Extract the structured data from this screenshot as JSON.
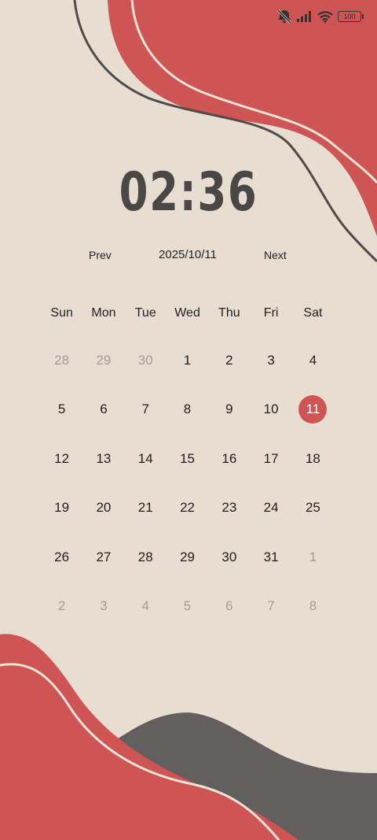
{
  "status_bar": {
    "icons": [
      "mute-icon",
      "signal-icon",
      "wifi-icon"
    ],
    "battery_level": "100"
  },
  "clock": {
    "time": "02:36"
  },
  "navigation": {
    "prev_label": "Prev",
    "current_date": "2025/10/11",
    "next_label": "Next"
  },
  "calendar": {
    "weekdays": [
      "Sun",
      "Mon",
      "Tue",
      "Wed",
      "Thu",
      "Fri",
      "Sat"
    ],
    "days": [
      {
        "label": "28",
        "muted": true
      },
      {
        "label": "29",
        "muted": true
      },
      {
        "label": "30",
        "muted": true
      },
      {
        "label": "1"
      },
      {
        "label": "2"
      },
      {
        "label": "3"
      },
      {
        "label": "4"
      },
      {
        "label": "5"
      },
      {
        "label": "6"
      },
      {
        "label": "7"
      },
      {
        "label": "8"
      },
      {
        "label": "9"
      },
      {
        "label": "10"
      },
      {
        "label": "11",
        "selected": true
      },
      {
        "label": "12"
      },
      {
        "label": "13"
      },
      {
        "label": "14"
      },
      {
        "label": "15"
      },
      {
        "label": "16"
      },
      {
        "label": "17"
      },
      {
        "label": "18"
      },
      {
        "label": "19"
      },
      {
        "label": "20"
      },
      {
        "label": "21"
      },
      {
        "label": "22"
      },
      {
        "label": "23"
      },
      {
        "label": "24"
      },
      {
        "label": "25"
      },
      {
        "label": "26"
      },
      {
        "label": "27"
      },
      {
        "label": "28"
      },
      {
        "label": "29"
      },
      {
        "label": "30"
      },
      {
        "label": "31"
      },
      {
        "label": "1",
        "muted": true
      },
      {
        "label": "2",
        "muted": true
      },
      {
        "label": "3",
        "muted": true
      },
      {
        "label": "4",
        "muted": true
      },
      {
        "label": "5",
        "muted": true
      },
      {
        "label": "6",
        "muted": true
      },
      {
        "label": "7",
        "muted": true
      },
      {
        "label": "8",
        "muted": true
      }
    ]
  },
  "colors": {
    "background": "#e8ddd1",
    "accent_red": "#cf5454",
    "dark_gray": "#635f5f",
    "text": "#1e1e1e",
    "muted_text": "#a49c96"
  }
}
